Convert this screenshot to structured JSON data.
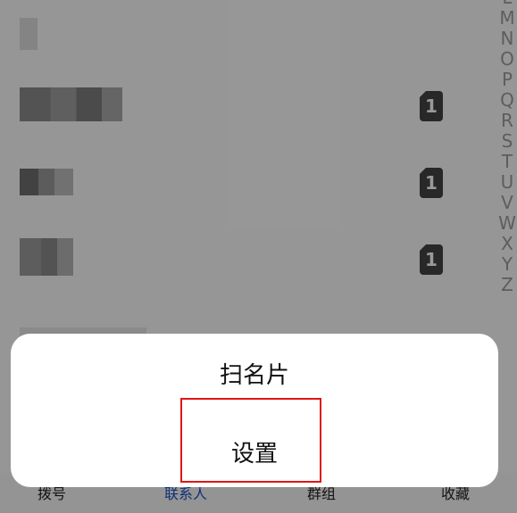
{
  "alphabet_index": [
    "L",
    "M",
    "N",
    "O",
    "P",
    "Q",
    "R",
    "S",
    "T",
    "U",
    "V",
    "W",
    "X",
    "Y",
    "Z"
  ],
  "contacts": [
    {
      "sim_badge": ""
    },
    {
      "sim_badge": "1"
    },
    {
      "sim_badge": "1"
    },
    {
      "sim_badge": "1"
    }
  ],
  "tab_bar": {
    "tabs": [
      {
        "label": "拨号",
        "active": false
      },
      {
        "label": "联系人",
        "active": true
      },
      {
        "label": "群组",
        "active": false
      },
      {
        "label": "收藏",
        "active": false
      }
    ]
  },
  "action_sheet": {
    "items": [
      {
        "label": "扫名片"
      },
      {
        "label": "设置"
      }
    ],
    "highlight_color": "#e01515"
  }
}
